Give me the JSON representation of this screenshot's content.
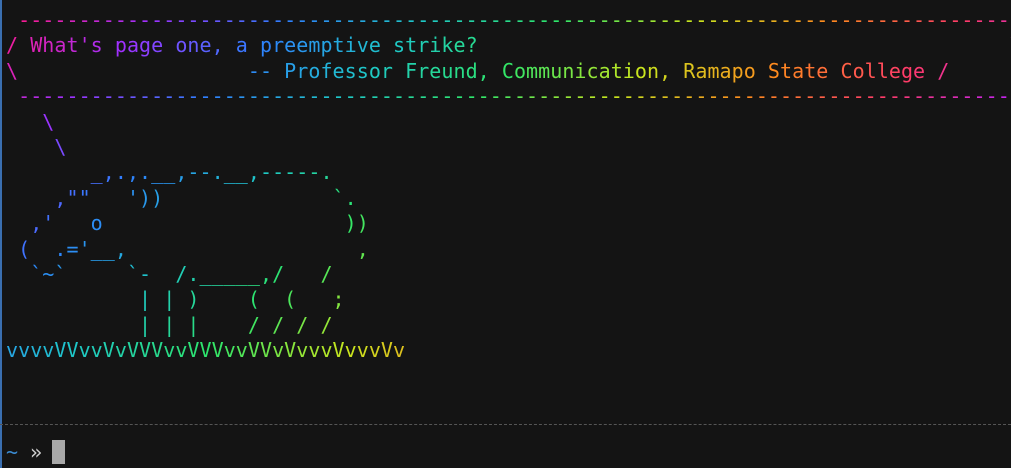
{
  "terminal": {
    "art_lines": [
      " ----------------------------------------------------------------------------------",
      "/ What's page one, a preemptive strike?                                            \\",
      "\\                   -- Professor Freund, Communication, Ramapo State College /",
      " ----------------------------------------------------------------------------------",
      "   \\",
      "    \\",
      "       _,.,.__,--.__,-----.",
      "    ,\"\"   '))              `.",
      "  ,'   o                    ))",
      " (  .='__,                   ,",
      "  `~`     `-  /._____,/   /",
      "           | | )    (  (   ;",
      "           | | |    / / / /",
      "vvvvVVvvVvVVVvvVVVvvVVvVvvvVvvvVv"
    ],
    "prompt": {
      "cwd": "~",
      "symbol": "»"
    },
    "colors": {
      "background": "#141414",
      "rainbow_stops": [
        "#ff1a8c",
        "#a030ff",
        "#2f7fff",
        "#1ec8c8",
        "#2ee66a",
        "#c8e61e",
        "#ff8a1e",
        "#ff3a6a",
        "#c020ff"
      ]
    }
  }
}
